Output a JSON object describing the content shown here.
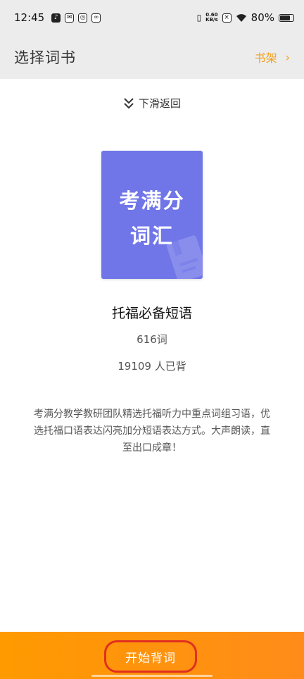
{
  "status_bar": {
    "time": "12:45",
    "net_speed_value": "0.60",
    "net_speed_unit": "KB/s",
    "battery": "80%"
  },
  "header": {
    "title": "选择词书",
    "bookshelf_label": "书架",
    "chevron": "›"
  },
  "swipe_back": {
    "label": "下滑返回"
  },
  "book": {
    "cover_line1": "考满分",
    "cover_line2": "词汇",
    "title": "托福必备短语",
    "word_count": "616词",
    "learners": "19109 人已背",
    "description": "考满分教学教研团队精选托福听力中重点词组习语，优选托福口语表达闪亮加分短语表达方式。大声朗读，直至出口成章！",
    "cover_color": "#7076e8"
  },
  "bottom": {
    "start_label": "开始背词",
    "accent": "#ff9a00"
  }
}
